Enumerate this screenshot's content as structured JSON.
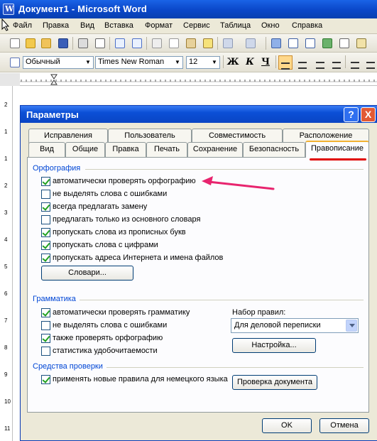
{
  "window": {
    "title": "Документ1 - Microsoft Word"
  },
  "menu": [
    "Файл",
    "Правка",
    "Вид",
    "Вставка",
    "Формат",
    "Сервис",
    "Таблица",
    "Окно",
    "Справка"
  ],
  "formatting": {
    "style": "Обычный",
    "font": "Times New Roman",
    "size": "12",
    "bold": "Ж",
    "italic": "К",
    "underline": "Ч"
  },
  "dialog": {
    "title": "Параметры",
    "help": "?",
    "close": "X",
    "tabs_row1": [
      "Исправления",
      "Пользователь",
      "Совместимость",
      "Расположение"
    ],
    "tabs_row2": [
      "Вид",
      "Общие",
      "Правка",
      "Печать",
      "Сохранение",
      "Безопасность",
      "Правописание"
    ],
    "spelling": {
      "heading": "Орфография",
      "options": [
        {
          "label": "автоматически проверять орфографию",
          "checked": true
        },
        {
          "label": "не выделять слова с ошибками",
          "checked": false
        },
        {
          "label": "всегда предлагать замену",
          "checked": true
        },
        {
          "label": "предлагать только из основного словаря",
          "checked": false
        },
        {
          "label": "пропускать слова из прописных букв",
          "checked": true
        },
        {
          "label": "пропускать слова с цифрами",
          "checked": true
        },
        {
          "label": "пропускать адреса Интернета и имена файлов",
          "checked": true
        }
      ],
      "dictionaries_button": "Словари..."
    },
    "grammar": {
      "heading": "Грамматика",
      "options": [
        {
          "label": "автоматически проверять грамматику",
          "checked": true
        },
        {
          "label": "не выделять слова с ошибками",
          "checked": false
        },
        {
          "label": "также проверять орфографию",
          "checked": true
        },
        {
          "label": "статистика удобочитаемости",
          "checked": false
        }
      ],
      "ruleset_label": "Набор правил:",
      "ruleset_value": "Для деловой переписки",
      "settings_button": "Настройка..."
    },
    "proofing": {
      "heading": "Средства проверки",
      "options": [
        {
          "label": "применять новые правила для немецкого языка",
          "checked": true
        }
      ],
      "check_button": "Проверка документа"
    },
    "ok": "OK",
    "cancel": "Отмена"
  },
  "annotation_colors": {
    "arrow": "#e8246e",
    "underline": "#e00000"
  },
  "vruler_numbers": [
    "2",
    "1",
    "1",
    "2",
    "3",
    "4",
    "5",
    "6",
    "7",
    "8",
    "9",
    "10",
    "11"
  ]
}
